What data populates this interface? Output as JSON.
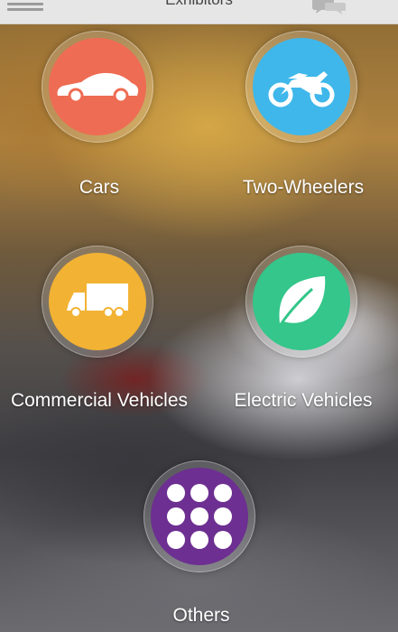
{
  "header": {
    "title": "Exhibitors"
  },
  "colors": {
    "cars": "#ee6c53",
    "two_wheelers": "#3fb7ea",
    "commercial": "#f2b233",
    "electric": "#34c68a",
    "others": "#6d2f91"
  },
  "categories": [
    {
      "label": "Cars",
      "icon": "car-icon"
    },
    {
      "label": "Two-Wheelers",
      "icon": "motorcycle-icon"
    },
    {
      "label": "Commercial Vehicles",
      "icon": "truck-icon"
    },
    {
      "label": "Electric Vehicles",
      "icon": "leaf-icon"
    },
    {
      "label": "Others",
      "icon": "grid-dots-icon"
    }
  ]
}
